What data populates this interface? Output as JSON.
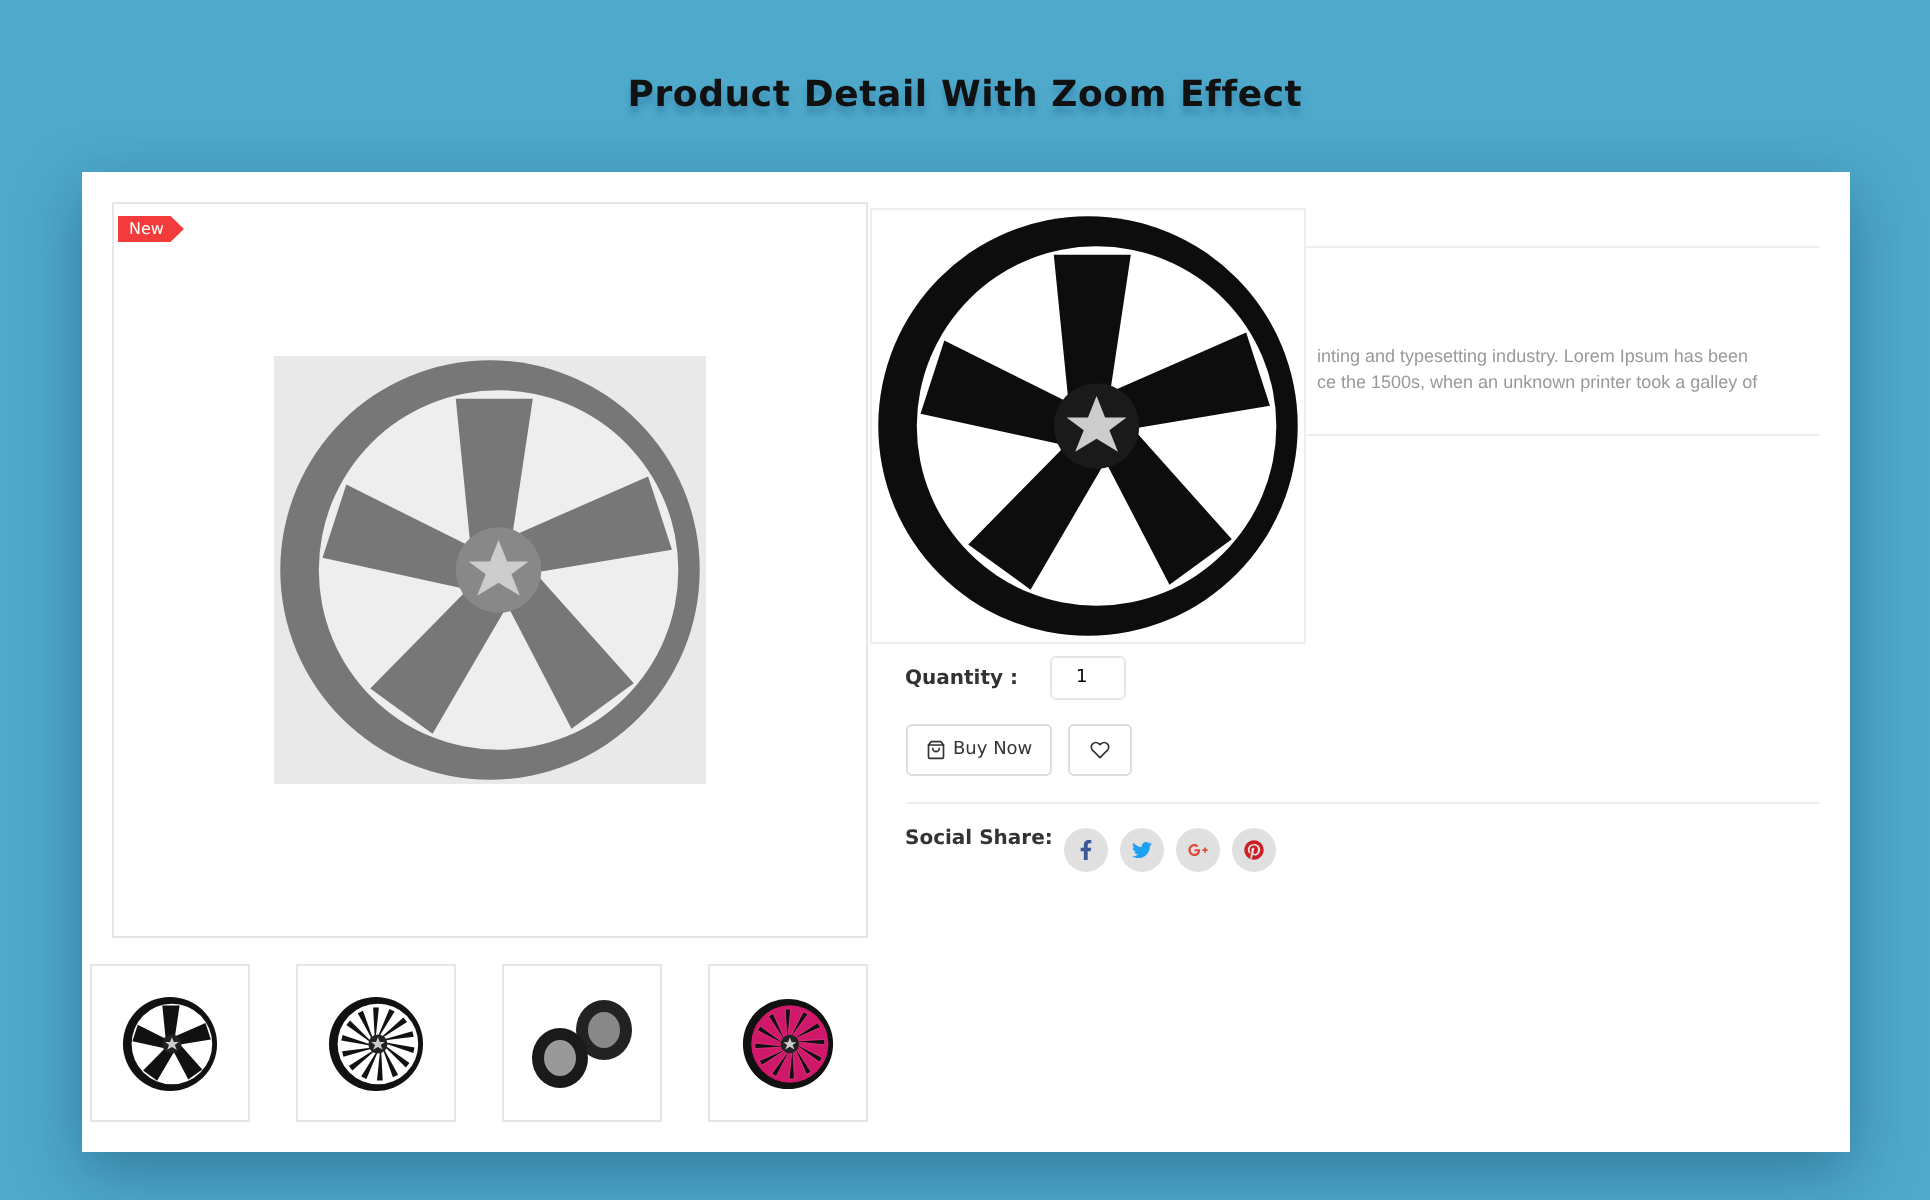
{
  "page_title": "Product Detail With Zoom Effect",
  "product": {
    "badge": "New",
    "description_lines": [
      "inting and typesetting industry. Lorem Ipsum has been",
      "ce the 1500s, when an unknown printer took a galley of"
    ],
    "quantity": {
      "label": "Quantity :",
      "value": "1"
    },
    "buy_button": "Buy Now",
    "social": {
      "label": "Social Share:",
      "networks": [
        {
          "kind": "facebook"
        },
        {
          "kind": "twitter"
        },
        {
          "kind": "google-plus"
        },
        {
          "kind": "pinterest"
        }
      ]
    }
  },
  "thumbnails": [
    {
      "kind": "five-spoke"
    },
    {
      "kind": "multi-spoke"
    },
    {
      "kind": "pair"
    },
    {
      "kind": "pink-multi-spoke"
    }
  ]
}
